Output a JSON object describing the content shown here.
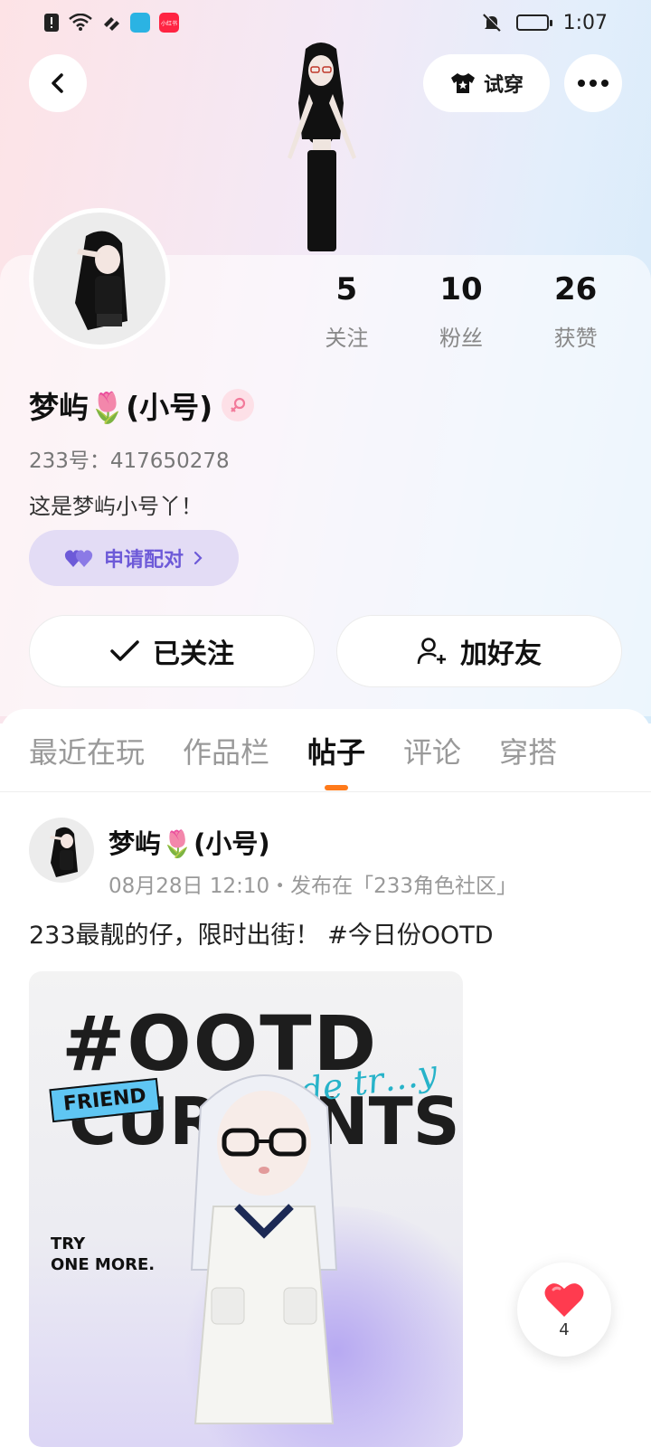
{
  "status_bar": {
    "time": "1:07",
    "app_badge_label": "小红书"
  },
  "header": {
    "try_on_label": "试穿"
  },
  "profile": {
    "stats": [
      {
        "value": "5",
        "label": "关注"
      },
      {
        "value": "10",
        "label": "粉丝"
      },
      {
        "value": "26",
        "label": "获赞"
      }
    ],
    "username": "梦屿🌷(小号)",
    "user_id": "233号：417650278",
    "bio": "这是梦屿小号丫！",
    "pair_label": "申请配对",
    "follow_label": "已关注",
    "add_friend_label": "加好友"
  },
  "tabs": [
    {
      "label": "最近在玩",
      "active": false
    },
    {
      "label": "作品栏",
      "active": false
    },
    {
      "label": "帖子",
      "active": true
    },
    {
      "label": "评论",
      "active": false
    },
    {
      "label": "穿搭",
      "active": false
    }
  ],
  "post": {
    "author": "梦屿🌷(小号)",
    "meta": "08月28日 12:10・发布在「233角色社区」",
    "text": "233最靓的仔，限时出街！ #今日份OOTD",
    "image": {
      "title": "#OOTD",
      "subtitle": "CURRENTS",
      "friend_tag": "FRIEND",
      "script": "de tr…y",
      "try_line1": "TRY",
      "try_line2": "ONE MORE."
    }
  },
  "like": {
    "count": "4"
  },
  "colors": {
    "accent_orange": "#ff7a1a",
    "pair_purple": "#6d5ad8",
    "like_red": "#ff3b4f"
  }
}
